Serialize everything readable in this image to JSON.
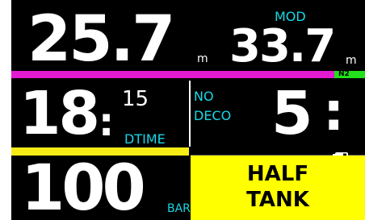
{
  "depth": {
    "value": "25.7",
    "unit": "m"
  },
  "mod": {
    "label": "MOD",
    "value": "33.7",
    "unit": "m"
  },
  "gas_bar": {
    "label": "N2",
    "color": "#e21ad2",
    "indicator_color": "#22e01c"
  },
  "dive_time": {
    "minutes": "18",
    "colon": ":",
    "seconds": "15",
    "label": "DTIME"
  },
  "deco": {
    "status_line1": "NO",
    "status_line2": "DECO",
    "value": "5",
    "colon": ":"
  },
  "separator": {
    "color": "#f7ec16"
  },
  "battery": {
    "icon": "battery-icon"
  },
  "tank": {
    "pressure": "100",
    "unit": "BAR"
  },
  "alert": {
    "line1": "HALF",
    "line2": "TANK",
    "bg_color": "#ffff00"
  }
}
